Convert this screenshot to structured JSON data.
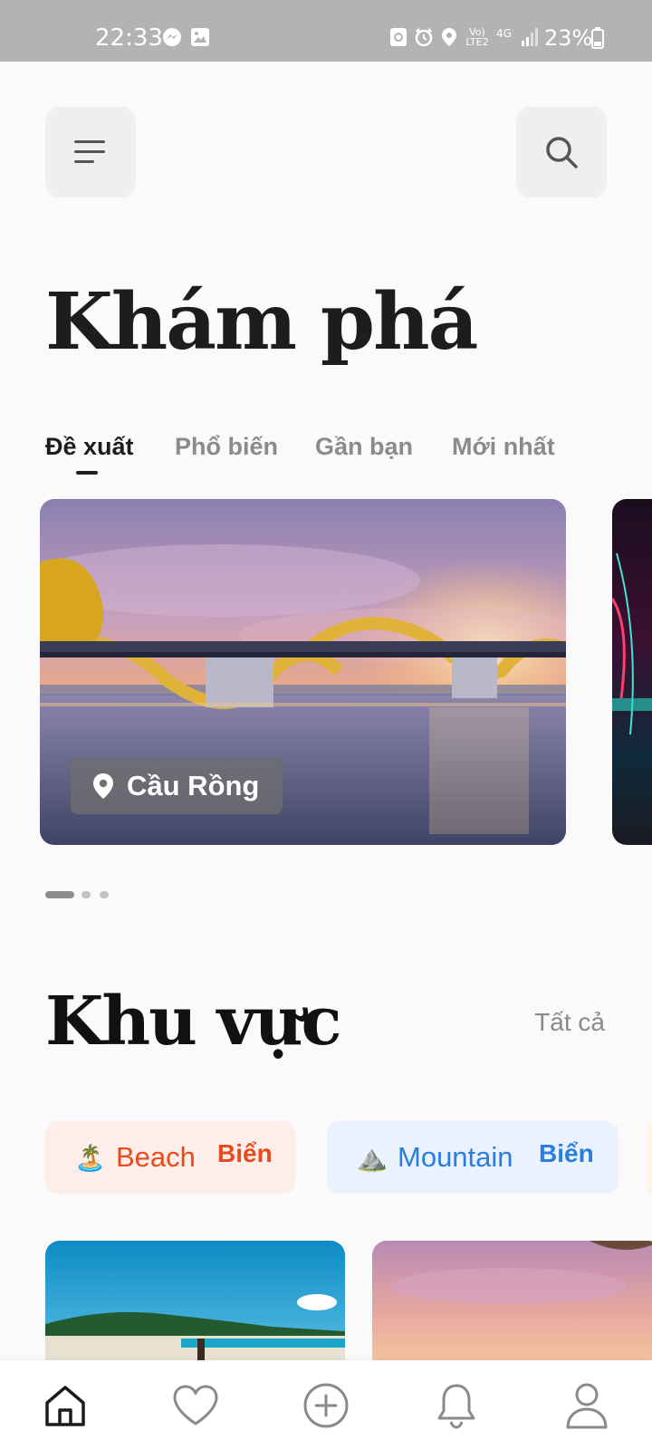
{
  "status_bar": {
    "time": "22:33",
    "signal_label": "Vo) LTE2",
    "network": "4G",
    "battery": "23%",
    "icons": [
      "messenger-icon",
      "gallery-icon",
      "sync-icon",
      "alarm-icon",
      "location-icon",
      "signal-icon",
      "battery-icon"
    ]
  },
  "header": {
    "menu_icon": "menu-icon",
    "search_icon": "search-icon",
    "title": "Khám phá"
  },
  "tabs": [
    {
      "label": "Đề xuất",
      "active": true
    },
    {
      "label": "Phổ biến",
      "active": false
    },
    {
      "label": "Gần bạn",
      "active": false
    },
    {
      "label": "Mới nhất",
      "active": false
    }
  ],
  "carousel": {
    "items": [
      {
        "location": "Cầu Rồng",
        "icon": "map-pin-icon"
      }
    ],
    "page_count": 3,
    "active_index": 0
  },
  "regions_section": {
    "title": "Khu vực",
    "see_all": "Tất cả",
    "chips": [
      {
        "emoji": "🏝️",
        "name": "Beach",
        "sub": "Biển",
        "color": "#e8491d",
        "bg": "#fdeeea"
      },
      {
        "emoji": "⛰️",
        "name": "Mountain",
        "sub": "Biển",
        "color": "#2a7de1",
        "bg": "#eaf2fd"
      }
    ]
  },
  "bottom_nav": [
    {
      "icon": "home-icon",
      "active": true
    },
    {
      "icon": "heart-icon",
      "active": false
    },
    {
      "icon": "plus-circle-icon",
      "active": false
    },
    {
      "icon": "bell-icon",
      "active": false
    },
    {
      "icon": "user-icon",
      "active": false
    }
  ]
}
